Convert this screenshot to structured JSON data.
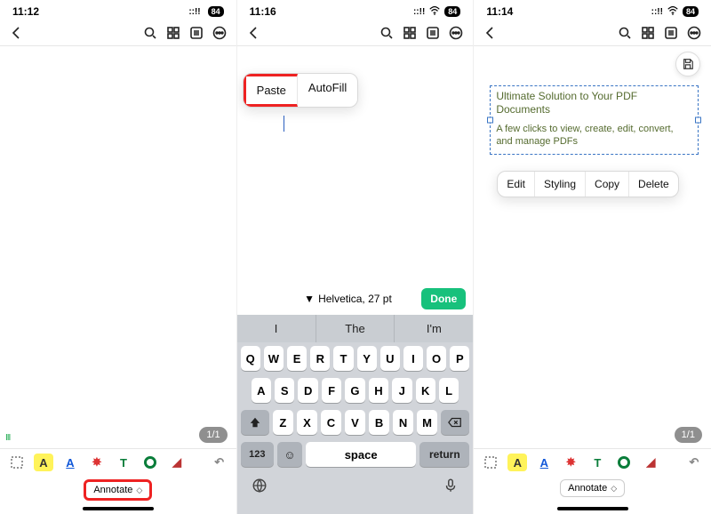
{
  "status": {
    "battery": "84"
  },
  "panes": [
    {
      "time": "11:12"
    },
    {
      "time": "11:16"
    },
    {
      "time": "11:14"
    }
  ],
  "toolbar": {
    "highlight": "A",
    "underline": "A",
    "strike": "A",
    "text": "T",
    "page_indicator": "1/1",
    "annotate_tag": "Annotate"
  },
  "pane1": {
    "context_menu": {
      "paste": "Paste",
      "autofill": "AutoFill"
    }
  },
  "pane2": {
    "fontbar": {
      "label": "Helvetica, 27 pt",
      "done": "Done"
    },
    "suggestions": [
      "I",
      "The",
      "I'm"
    ],
    "rows": [
      [
        "Q",
        "W",
        "E",
        "R",
        "T",
        "Y",
        "U",
        "I",
        "O",
        "P"
      ],
      [
        "A",
        "S",
        "D",
        "F",
        "G",
        "H",
        "J",
        "K",
        "L"
      ],
      [
        "Z",
        "X",
        "C",
        "V",
        "B",
        "N",
        "M"
      ]
    ],
    "numkey": "123",
    "space": "space",
    "return": "return"
  },
  "pane3": {
    "text": {
      "title": "Ultimate Solution to Your PDF Documents",
      "body": "A few clicks to view, create, edit, convert, and manage PDFs"
    },
    "context_menu": {
      "edit": "Edit",
      "styling": "Styling",
      "copy": "Copy",
      "delete": "Delete"
    }
  }
}
